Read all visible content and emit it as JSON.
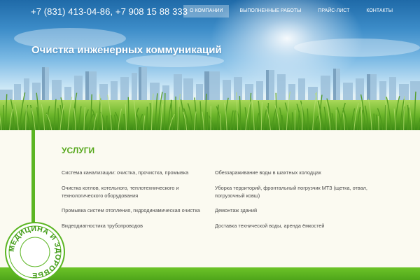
{
  "header": {
    "phone": "+7 (831) 413-04-86, +7 908 15 88 333",
    "nav": [
      {
        "label": "О КОМПАНИИ",
        "active": true
      },
      {
        "label": "ВЫПОЛНЕННЫЕ РАБОТЫ",
        "active": false
      },
      {
        "label": "ПРАЙС-ЛИСТ",
        "active": false
      },
      {
        "label": "КОНТАКТЫ",
        "active": false
      }
    ]
  },
  "hero": {
    "title": "Очистка инженерных коммуникаций"
  },
  "services": {
    "heading": "УСЛУГИ",
    "left": [
      "Система канализации: очистка, прочистка, промывка",
      "Очистка котлов, котельного, теплотехнического и технологического оборудования",
      "Промывка систем отопления, гидродинамическая очистка",
      "Видеодиагностика трубопроводов"
    ],
    "right": [
      "Обеззараживание воды в шахтных колодцах",
      "Уборка территорий, фронтальный погрузчик МТЗ (щетка, отвал, погрузочный ковш)",
      "Демонтаж зданий",
      "Доставка технической воды, аренда ёмкостей"
    ]
  },
  "stamp": {
    "text": "МЕДИЦИНА И ЗДОРОВЬЕ"
  },
  "colors": {
    "accent_green": "#5bb522",
    "heading_green": "#57a81d",
    "body_text": "#4a4a4a",
    "background": "#fbfaf1"
  }
}
